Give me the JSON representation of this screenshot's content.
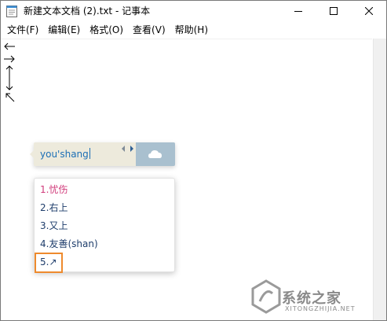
{
  "window": {
    "title": "新建文本文档 (2).txt - 记事本"
  },
  "menu": [
    {
      "label": "文件(F)"
    },
    {
      "label": "编辑(E)"
    },
    {
      "label": "格式(O)"
    },
    {
      "label": "查看(V)"
    },
    {
      "label": "帮助(H)"
    }
  ],
  "editor": {
    "content_icons": [
      "left-arrow-icon",
      "right-arrow-icon",
      "up-down-arrow-icon",
      "up-left-arrow-icon"
    ]
  },
  "ime": {
    "composition": "you'shang",
    "candidates": [
      {
        "label": "1.忧伤"
      },
      {
        "label": "2.右上"
      },
      {
        "label": "3.又上"
      },
      {
        "label": "4.友善(shan)"
      },
      {
        "label": "5.↗"
      }
    ],
    "highlight_color": "#ee8a2d",
    "active_color": "#d03a7a"
  },
  "watermark": {
    "text": "系统之家",
    "sub": "XITONGZHIJIA.NET"
  }
}
